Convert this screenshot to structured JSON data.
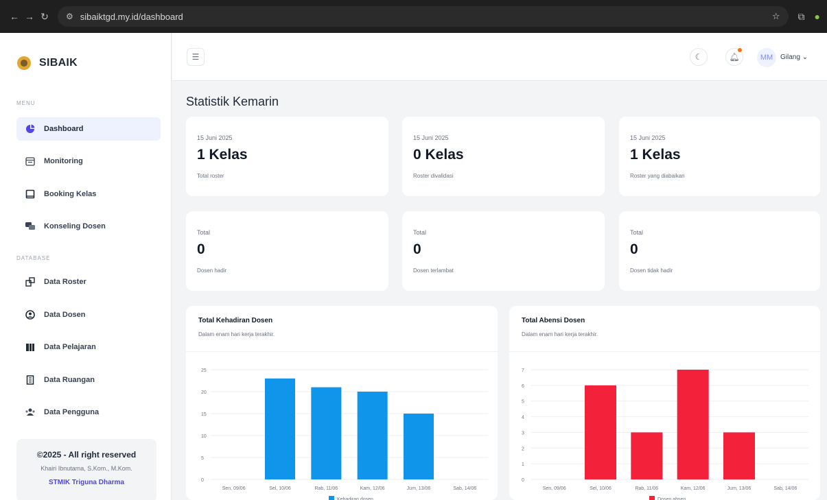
{
  "browser": {
    "url": "sibaiktgd.my.id/dashboard"
  },
  "sidebar": {
    "brand": "SIBAIK",
    "menu_label": "MENU",
    "database_label": "DATABASE",
    "menu_items": [
      {
        "label": "Dashboard",
        "icon": "dashboard-icon"
      },
      {
        "label": "Monitoring",
        "icon": "calendar-icon"
      },
      {
        "label": "Booking Kelas",
        "icon": "book-icon"
      },
      {
        "label": "Konseling Dosen",
        "icon": "chat-icon"
      }
    ],
    "db_items": [
      {
        "label": "Data Roster",
        "icon": "table-icon"
      },
      {
        "label": "Data Dosen",
        "icon": "user-circle-icon"
      },
      {
        "label": "Data Pelajaran",
        "icon": "books-icon"
      },
      {
        "label": "Data Ruangan",
        "icon": "building-icon"
      },
      {
        "label": "Data Pengguna",
        "icon": "users-icon"
      }
    ],
    "footer": {
      "copyright": "©2025 - All right reserved",
      "author": "Khairi Ibnutama, S.Kom., M.Kom.",
      "institution": "STMIK Triguna Dharma"
    }
  },
  "topbar": {
    "avatar_initials": "MM",
    "user_name": "Gilang"
  },
  "main": {
    "title": "Statistik Kemarin",
    "stats_top": [
      {
        "date": "15 Juni 2025",
        "value": "1 Kelas",
        "desc": "Total roster"
      },
      {
        "date": "15 Juni 2025",
        "value": "0 Kelas",
        "desc": "Roster divalidasi"
      },
      {
        "date": "15 Juni 2025",
        "value": "1 Kelas",
        "desc": "Roster yang diabaikan"
      }
    ],
    "stats_bottom": [
      {
        "date": "Total",
        "value": "0",
        "desc": "Dosen hadir"
      },
      {
        "date": "Total",
        "value": "0",
        "desc": "Dosen terlambat"
      },
      {
        "date": "Total",
        "value": "0",
        "desc": "Dosen tidak hadir"
      }
    ]
  },
  "colors": {
    "accent": "#4f46e5",
    "bar_blue": "#0f96ea",
    "bar_red": "#f4213a"
  },
  "chart_data": [
    {
      "type": "bar",
      "title": "Total Kehadiran Dosen",
      "subtitle": "Dalam enam hari kerja terakhir.",
      "categories": [
        "Sen, 09/06",
        "Sel, 10/06",
        "Rab, 11/06",
        "Kam, 12/06",
        "Jum, 13/06",
        "Sab, 14/06"
      ],
      "series": [
        {
          "name": "Kehadiran dosen",
          "values": [
            0,
            23,
            21,
            20,
            15,
            0
          ]
        }
      ],
      "yticks": [
        "0",
        "5",
        "10",
        "15",
        "20",
        "25"
      ],
      "ylim": [
        0,
        25
      ],
      "grid": true,
      "legend": "bottom"
    },
    {
      "type": "bar",
      "title": "Total Abensi Dosen",
      "subtitle": "Dalam enam hari kerja terakhir.",
      "categories": [
        "Sen, 09/06",
        "Sel, 10/06",
        "Rab, 11/06",
        "Kam, 12/06",
        "Jum, 13/06",
        "Sab, 14/06"
      ],
      "series": [
        {
          "name": "Dosen absen",
          "values": [
            0,
            6,
            3,
            7,
            3,
            0
          ]
        }
      ],
      "yticks": [
        "0",
        "1",
        "2",
        "3",
        "4",
        "5",
        "6",
        "7"
      ],
      "ylim": [
        0,
        7
      ],
      "grid": true,
      "legend": "bottom"
    }
  ]
}
